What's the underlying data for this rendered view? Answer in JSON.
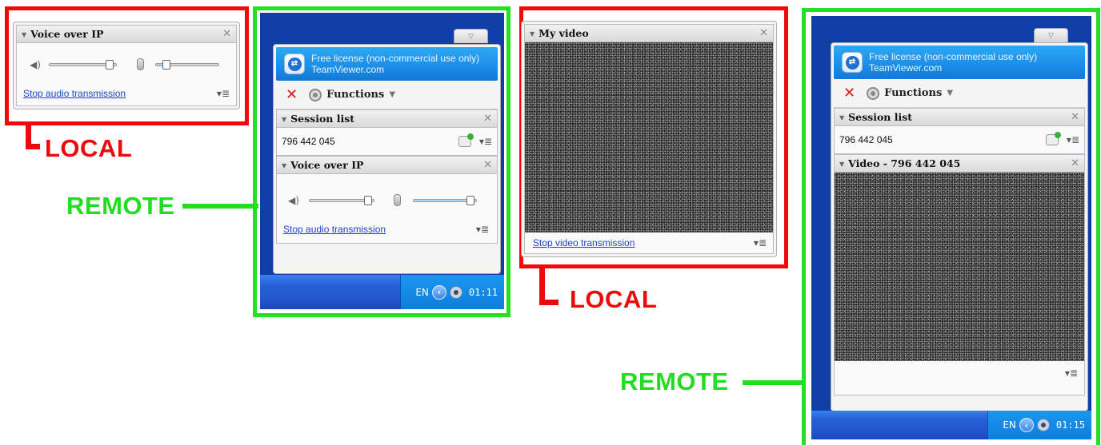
{
  "annotations": {
    "local_label": "LOCAL",
    "remote_label": "REMOTE",
    "colors": {
      "local": "#ee0a0a",
      "remote": "#22dd22"
    }
  },
  "local_voip": {
    "title": "Voice over IP",
    "link": "Stop audio transmission",
    "speaker_volume": 0.95,
    "mic_volume": 0.12
  },
  "remote1": {
    "license_line1": "Free license (non-commercial use only)",
    "license_line2": "TeamViewer.com",
    "functions_label": "Functions",
    "session_list_title": "Session list",
    "session_id": "796 442 045",
    "voip_title": "Voice over IP",
    "voip_link": "Stop audio transmission",
    "speaker_volume": 0.9,
    "mic_volume": 0.95,
    "taskbar": {
      "lang": "EN",
      "clock": "01:11"
    }
  },
  "local_video": {
    "title": "My video",
    "link": "Stop video transmission"
  },
  "remote2": {
    "license_line1": "Free license (non-commercial use only)",
    "license_line2": "TeamViewer.com",
    "functions_label": "Functions",
    "session_list_title": "Session list",
    "session_id": "796 442 045",
    "video_title": "Video - 796 442 045",
    "taskbar": {
      "lang": "EN",
      "clock": "01:15"
    }
  },
  "icons": [
    "collapse-triangle-icon",
    "close-icon",
    "speaker-icon",
    "microphone-icon",
    "menu-icon",
    "teamviewer-logo-icon",
    "red-x-icon",
    "gear-icon",
    "chevron-down-icon",
    "session-connect-icon",
    "tray-arrow-icon",
    "tray-speaker-icon"
  ]
}
